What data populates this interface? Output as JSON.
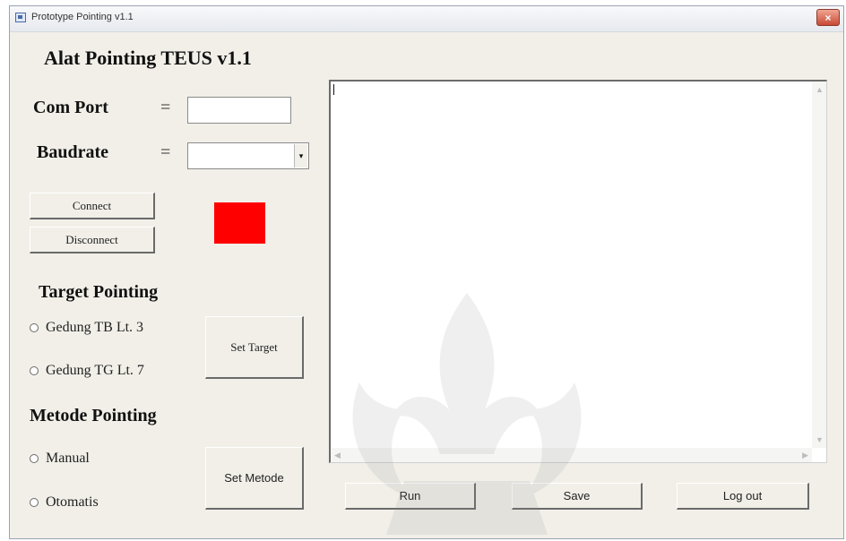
{
  "window": {
    "title": "Prototype Pointing v1.1",
    "close_glyph": "×"
  },
  "app": {
    "heading": "Alat Pointing TEUS v1.1"
  },
  "connection": {
    "com_port_label": "Com Port",
    "com_port_eq": "=",
    "com_port_value": "",
    "baudrate_label": "Baudrate",
    "baudrate_eq": "=",
    "baudrate_value": "",
    "combo_arrow_glyph": "▾",
    "connect_label": "Connect",
    "disconnect_label": "Disconnect",
    "status_color": "#ff0000"
  },
  "target": {
    "heading": "Target Pointing",
    "options": [
      "Gedung TB Lt. 3",
      "Gedung TG Lt. 7"
    ],
    "set_label": "Set Target"
  },
  "method": {
    "heading": "Metode Pointing",
    "options": [
      "Manual",
      "Otomatis"
    ],
    "set_label": "Set Metode"
  },
  "log": {
    "value": ""
  },
  "actions": {
    "run_label": "Run",
    "save_label": "Save",
    "logout_label": "Log out"
  },
  "icons": {
    "app": "window-icon",
    "close": "close-icon",
    "watermark": "university-emblem-watermark"
  }
}
